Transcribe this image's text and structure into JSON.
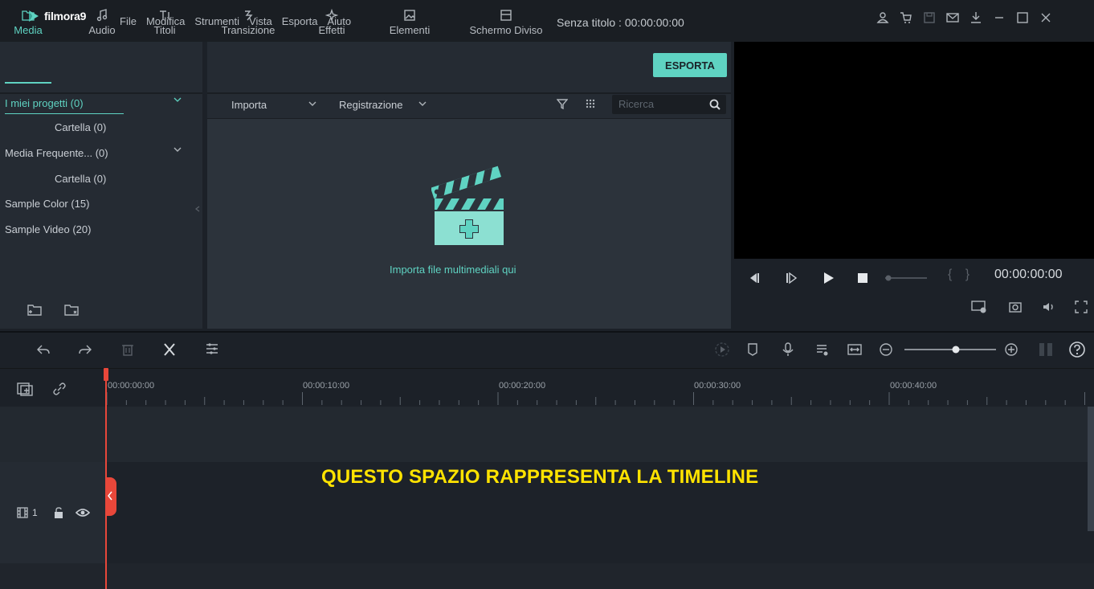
{
  "app": {
    "logo_text": "filmora9",
    "menu": [
      "File",
      "Modifica",
      "Strumenti",
      "Vista",
      "Esporta",
      "Aiuto"
    ],
    "doc_title": "Senza titolo : 00:00:00:00",
    "window_icons": [
      "user-icon",
      "cart-icon",
      "save-icon",
      "mail-icon",
      "download-icon",
      "minimize-icon",
      "maximize-icon",
      "close-icon"
    ]
  },
  "tabs": [
    {
      "label": "Media",
      "icon": "folder-icon",
      "active": true
    },
    {
      "label": "Audio",
      "icon": "music-note-icon",
      "active": false
    },
    {
      "label": "Titoli",
      "icon": "text-icon",
      "active": false
    },
    {
      "label": "Transizione",
      "icon": "transition-icon",
      "active": false
    },
    {
      "label": "Effetti",
      "icon": "effects-icon",
      "active": false
    },
    {
      "label": "Elementi",
      "icon": "image-icon",
      "active": false
    },
    {
      "label": "Schermo Diviso",
      "icon": "split-screen-icon",
      "active": false
    }
  ],
  "export_label": "ESPORTA",
  "library": {
    "items": [
      {
        "label": "I miei progetti (0)",
        "active": true,
        "expandable": true
      },
      {
        "label": "Cartella (0)",
        "indent": true
      },
      {
        "label": "Media Frequente... (0)",
        "expandable": true
      },
      {
        "label": "Cartella (0)",
        "indent": true
      },
      {
        "label": "Sample Color (15)"
      },
      {
        "label": "Sample Video (20)"
      }
    ]
  },
  "media_toolbar": {
    "import_label": "Importa",
    "record_label": "Registrazione",
    "search_placeholder": "Ricerca"
  },
  "dropzone_hint": "Importa file multimediali qui",
  "preview": {
    "timecode": "00:00:00:00",
    "braces": "{ }"
  },
  "ruler_labels": [
    "00:00:00:00",
    "00:00:10:00",
    "00:00:20:00",
    "00:00:30:00",
    "00:00:40:00"
  ],
  "track": {
    "number": "1"
  },
  "timeline_message": "QUESTO SPAZIO RAPPRESENTA LA TIMELINE",
  "colors": {
    "accent": "#5fd3c2",
    "playhead": "#e8473a",
    "message": "#ffe300"
  }
}
